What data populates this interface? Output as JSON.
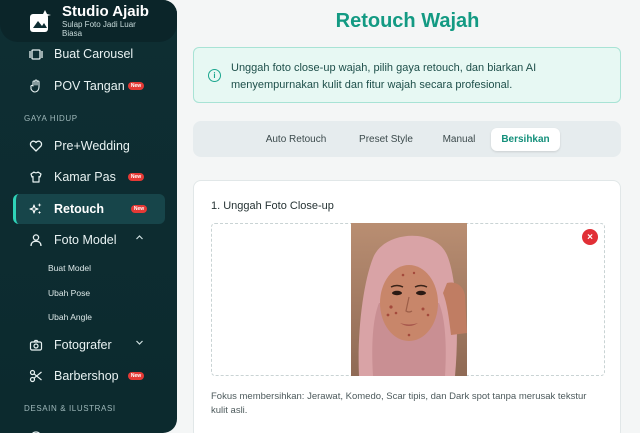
{
  "brand": {
    "title": "Studio Ajaib",
    "subtitle": "Sulap Foto Jadi Luar Biasa"
  },
  "sidebar": {
    "items": [
      {
        "label": "Buat Carousel"
      },
      {
        "label": "POV Tangan",
        "badge": "New"
      },
      {
        "label": "Pre+Wedding"
      },
      {
        "label": "Kamar Pas",
        "badge": "New"
      },
      {
        "label": "Retouch",
        "badge": "New"
      },
      {
        "label": "Foto Model"
      },
      {
        "label": "Fotografer"
      },
      {
        "label": "Barbershop",
        "badge": "New"
      }
    ],
    "sections": {
      "gaya_hidup": "GAYA HIDUP",
      "desain": "DESAIN & ILUSTRASI"
    },
    "foto_model_sub": [
      "Buat Model",
      "Ubah Pose",
      "Ubah Angle"
    ]
  },
  "main": {
    "title": "Retouch Wajah",
    "info_text": "Unggah foto close-up wajah, pilih gaya retouch, dan biarkan AI menyempurnakan kulit dan fitur wajah secara profesional.",
    "tabs": [
      {
        "label": "Auto Retouch"
      },
      {
        "label": "Preset Style"
      },
      {
        "label": "Manual"
      },
      {
        "label": "Bersihkan",
        "active": true
      }
    ],
    "upload": {
      "title": "1. Unggah Foto Close-up",
      "remove_symbol": "×",
      "hint": "Fokus membersihkan: Jerawat, Komedo, Scar tipis, dan Dark spot tanpa merusak tekstur kulit asli."
    }
  },
  "colors": {
    "accent": "#139a83",
    "sidebar_bg": "#0e2e33",
    "badge": "#e53935"
  }
}
